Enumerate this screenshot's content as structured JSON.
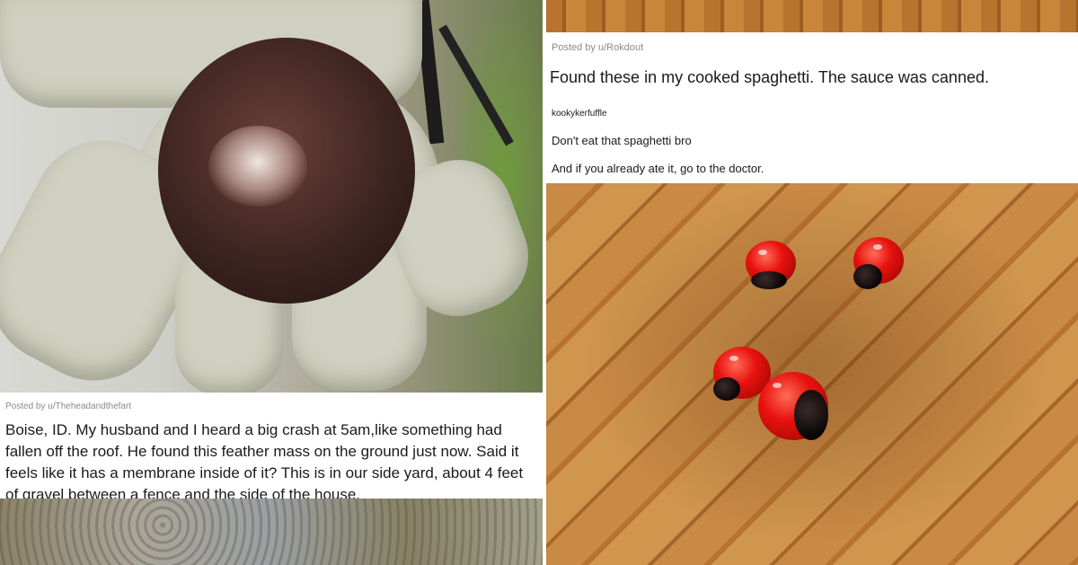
{
  "left_post": {
    "posted_by": "Posted by u/Theheadandthefart",
    "title": "Boise, ID. My husband and I heard a big crash at 5am,like something had fallen off the roof. He found this feather mass on the ground just now. Said it feels like it has a membrane inside of it? This is in our side yard, about 4 feet of gravel between a fence and the side of the house."
  },
  "right_post": {
    "posted_by": "Posted by u/Rokdout",
    "title": "Found these in my cooked spaghetti. The sauce was canned.",
    "comment": {
      "author": "kookykerfuffle",
      "lines": [
        "Don't eat that spaghetti bro",
        "And if you already ate it, go to the doctor."
      ]
    }
  },
  "colors": {
    "seed_red": "#e8120e",
    "seed_black": "#0b0606",
    "wood": "#c98a45",
    "text": "#1a1a1b",
    "meta_text": "#8a8a8a"
  }
}
